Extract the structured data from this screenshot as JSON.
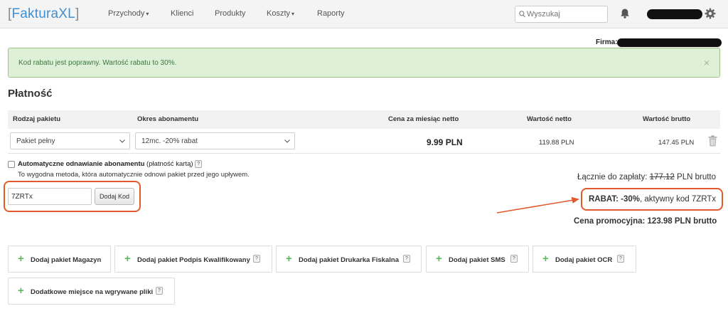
{
  "header": {
    "logo_bracket_left": "[",
    "logo_text": "FakturaXL",
    "logo_bracket_right": "]",
    "nav": [
      "Przychody",
      "Klienci",
      "Produkty",
      "Koszty",
      "Raporty"
    ],
    "search_placeholder": "Wyszukaj"
  },
  "firma_label": "Firma:",
  "alert": {
    "text": "Kod rabatu jest poprawny. Wartość rabatu to 30%.",
    "close": "×"
  },
  "page_title": "Płatność",
  "table": {
    "headers": [
      "Rodzaj pakietu",
      "Okres abonamentu",
      "Cena za miesiąc netto",
      "Wartość netto",
      "Wartość brutto"
    ],
    "package": "Pakiet pełny",
    "period": "12mc. -20% rabat",
    "monthly_price": "9.99 PLN",
    "net_value": "119.88 PLN",
    "gross_value": "147.45 PLN"
  },
  "auto_renew": {
    "label_bold": "Automatyczne odnawianie abonamentu",
    "label_rest": " (płatność kartą)",
    "help": "?",
    "description": "To wygodna metoda, która automatycznie odnowi pakiet przed jego upływem."
  },
  "coupon": {
    "value": "7ZRTx",
    "button": "Dodaj Kod"
  },
  "totals": {
    "total_prefix": "Łącznie do zapłaty: ",
    "total_old": "177.12",
    "total_suffix": " PLN brutto",
    "rabat_bold": "RABAT: -30%",
    "rabat_rest": ", aktywny kod 7ZRTx",
    "promo": "Cena promocyjna: 123.98 PLN brutto"
  },
  "addons": [
    {
      "label": "Dodaj pakiet Magazyn",
      "help": ""
    },
    {
      "label": "Dodaj pakiet Podpis Kwalifikowany",
      "help": "?"
    },
    {
      "label": "Dodaj pakiet Drukarka Fiskalna",
      "help": "?"
    },
    {
      "label": "Dodaj pakiet SMS",
      "help": "?"
    },
    {
      "label": "Dodaj pakiet OCR",
      "help": "?"
    },
    {
      "label": "Dodatkowe miejsce na wgrywane pliki",
      "help": "?"
    }
  ],
  "colors": {
    "logo_blue": "#3f8fd2",
    "alert_bg": "#dff0d8",
    "highlight_orange": "#e05a2b",
    "plus_green": "#5cb85c"
  }
}
